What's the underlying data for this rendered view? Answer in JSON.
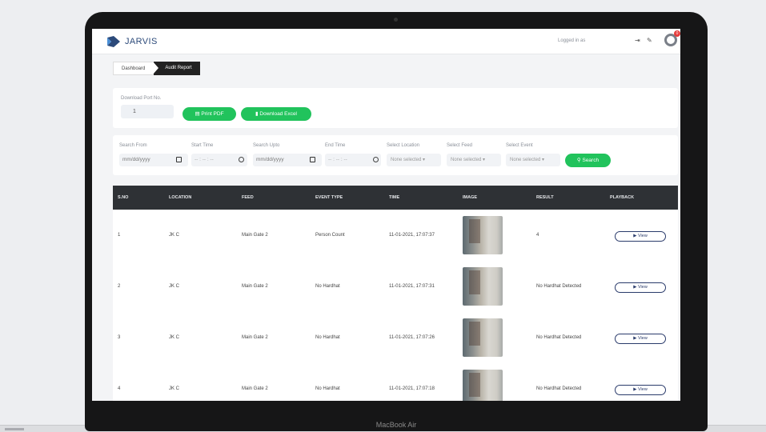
{
  "device": {
    "label": "MacBook Air"
  },
  "header": {
    "app_name": "JARVIS",
    "logged_in": "Logged in as",
    "logout_icon": "logout-icon",
    "settings_icon": "wrench-icon",
    "notification_count": "0"
  },
  "breadcrumb": {
    "items": [
      "Dashboard",
      "Audit Report"
    ]
  },
  "download": {
    "port_label": "Download Port No.",
    "port_value": "1",
    "print_pdf": "Print PDF",
    "download_excel": "Download Excel"
  },
  "filters": {
    "search_from_label": "Search From",
    "search_from_placeholder": "mm/dd/yyyy",
    "start_time_label": "Start Time",
    "start_time_placeholder": "-- : -- : --",
    "search_upto_label": "Search Upto",
    "search_upto_placeholder": "mm/dd/yyyy",
    "end_time_label": "End Time",
    "end_time_placeholder": "-- : -- : --",
    "location_label": "Select Location",
    "location_value": "None selected",
    "feed_label": "Select Feed",
    "feed_value": "None selected",
    "event_label": "Select Event",
    "event_value": "None selected",
    "search_button": "Search"
  },
  "table": {
    "headers": [
      "S.NO",
      "LOCATION",
      "FEED",
      "EVENT TYPE",
      "TIME",
      "IMAGE",
      "RESULT",
      "PLAYBACK"
    ],
    "view_label": "View",
    "rows": [
      {
        "sno": "1",
        "location": "JK C",
        "feed": "Main Gate 2",
        "event_type": "Person Count",
        "time": "11-01-2021, 17:07:37",
        "result": "4"
      },
      {
        "sno": "2",
        "location": "JK C",
        "feed": "Main Gate 2",
        "event_type": "No Hardhat",
        "time": "11-01-2021, 17:07:31",
        "result": "No Hardhat Detected"
      },
      {
        "sno": "3",
        "location": "JK C",
        "feed": "Main Gate 2",
        "event_type": "No Hardhat",
        "time": "11-01-2021, 17:07:26",
        "result": "No Hardhat Detected"
      },
      {
        "sno": "4",
        "location": "JK C",
        "feed": "Main Gate 2",
        "event_type": "No Hardhat",
        "time": "11-01-2021, 17:07:18",
        "result": "No Hardhat Detected"
      }
    ]
  },
  "colors": {
    "accent_green": "#21c35c",
    "header_dark": "#2e3135",
    "brand_blue": "#2c4a7a"
  }
}
